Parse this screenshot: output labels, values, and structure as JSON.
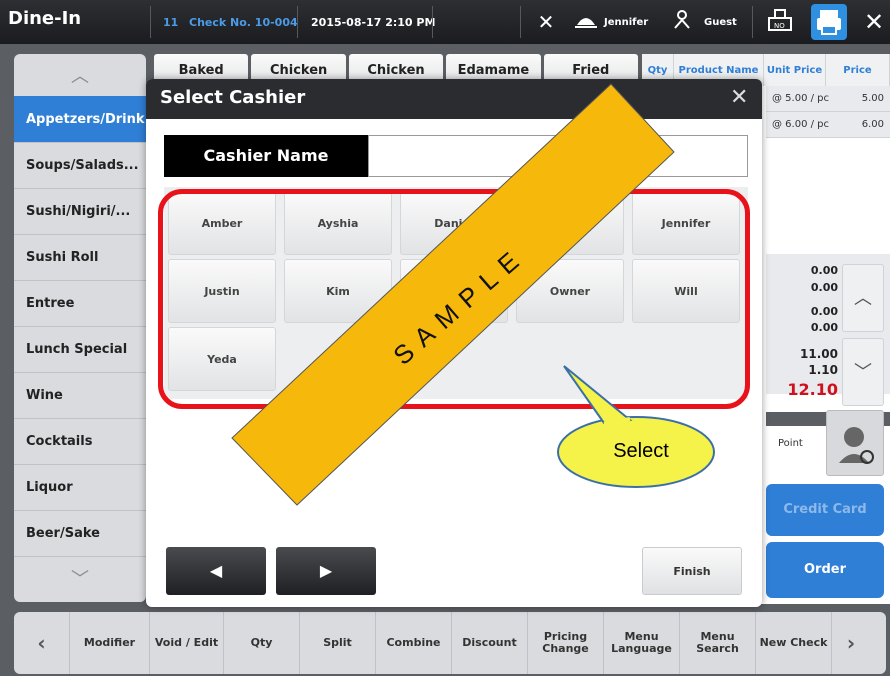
{
  "topbar": {
    "title": "Dine-In",
    "table": "11",
    "check_no": "Check No. 10-004",
    "datetime": "2015-08-17  2:10 PM",
    "user": "Jennifer",
    "guest": "Guest"
  },
  "categories": [
    "Appetzers/Drink",
    "Soups/Salads...",
    "Sushi/Nigiri/...",
    "Sushi Roll",
    "Entree",
    "Lunch Special",
    "Wine",
    "Cocktails",
    "Liquor",
    "Beer/Sake"
  ],
  "menu_tiles": [
    "Baked",
    "Chicken",
    "Chicken",
    "Edamame",
    "Fried"
  ],
  "order": {
    "headers": [
      "Qty",
      "Product Name",
      "Unit Price",
      "Price"
    ],
    "rows": [
      {
        "unit_price": "@ 5.00 / pc",
        "price": "5.00"
      },
      {
        "unit_price": "@ 6.00 / pc",
        "price": "6.00"
      }
    ],
    "totals": [
      "0.00",
      "0.00",
      "0.00",
      "0.00",
      "11.00",
      "1.10",
      "12.10"
    ],
    "point_label": "Point",
    "credit_card": "Credit Card",
    "order_button": "Order"
  },
  "bottom_bar": [
    "Modifier",
    "Void / Edit",
    "Qty",
    "Split",
    "Combine",
    "Discount",
    "Pricing Change",
    "Menu Language",
    "Menu Search",
    "New Check"
  ],
  "dialog": {
    "title": "Select Cashier",
    "name_label": "Cashier Name",
    "name_value": "",
    "cashiers": [
      "Amber",
      "Ayshia",
      "Daniel",
      "Jennifer",
      "Justin",
      "Kim",
      "Owner",
      "Will",
      "Yeda"
    ],
    "finish": "Finish"
  },
  "annotations": {
    "callout": "Select",
    "watermark": "SAMPLE"
  },
  "colors": {
    "accent_blue": "#2f7fd6",
    "highlight_red": "#e8121a",
    "callout_yellow": "#f5f24a",
    "watermark_orange": "#f6b80b",
    "total_red": "#d0101a"
  }
}
